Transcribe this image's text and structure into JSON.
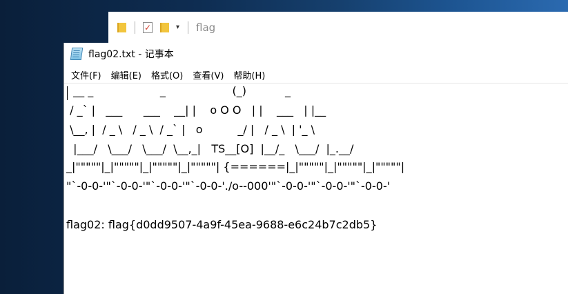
{
  "explorer": {
    "title": "flag",
    "icons": [
      "folder-icon",
      "properties-check-icon",
      "new-folder-icon",
      "dropdown-arrow-icon"
    ],
    "dropdown_glyph": "▾"
  },
  "notepad": {
    "window_title": "flag02.txt - 记事本",
    "menu": [
      {
        "label": "文件(F)"
      },
      {
        "label": "编辑(E)"
      },
      {
        "label": "格式(O)"
      },
      {
        "label": "查看(V)"
      },
      {
        "label": "帮助(H)"
      }
    ],
    "content_lines": [
      "  __ _                   _                   (_)           _",
      " / _` |   ___      ___    __| |    o O O   | |    ___   | |__",
      " \\__, |  / _ \\   / _ \\  / _` |   o          _/ |   / _ \\  | '_ \\",
      "  |___/   \\___/   \\___/  \\__,_|   TS__[O]  |__/_   \\___/  |_.__/",
      "_|\"\"\"\"\"|_|\"\"\"\"\"|_|\"\"\"\"\"|_|\"\"\"\"\"| {======|_|\"\"\"\"\"|_|\"\"\"\"\"|_|\"\"\"\"\"|",
      "\"`-0-0-'\"`-0-0-'\"`-0-0-'\"`-0-0-'./o--000'\"`-0-0-'\"`-0-0-'\"`-0-0-'",
      "",
      "flag02: flag{d0dd9507-4a9f-45ea-9688-e6c24b7c2db5}"
    ]
  },
  "colors": {
    "desktop_dark": "#0a1f3a",
    "desktop_light": "#2b6ab0",
    "window_bg": "#ffffff",
    "folder_yellow": "#f2c53d"
  }
}
